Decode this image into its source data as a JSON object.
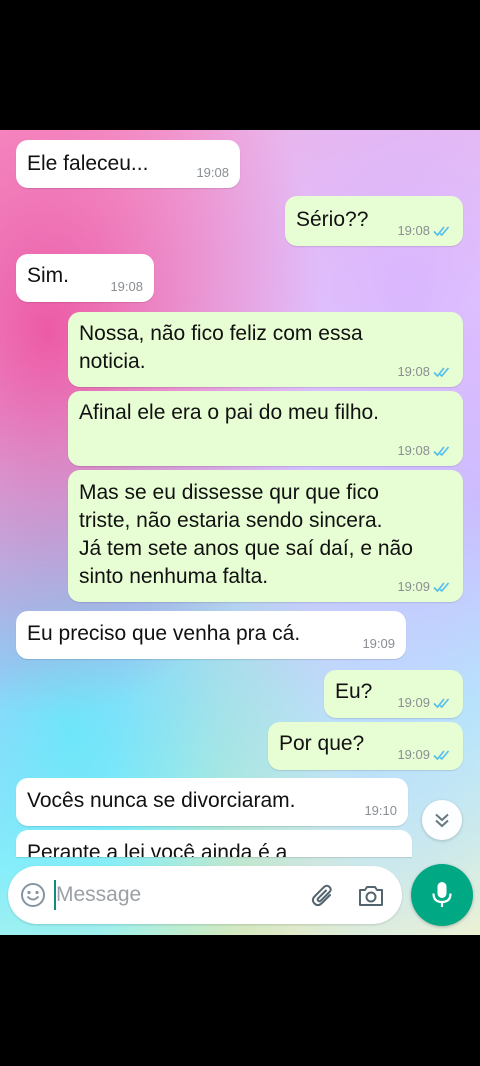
{
  "messages": [
    {
      "direction": "in",
      "text": "Ele faleceu...",
      "time": "19:08"
    },
    {
      "direction": "out",
      "text": "Sério??",
      "time": "19:08",
      "status": "read"
    },
    {
      "direction": "in",
      "text": "Sim.",
      "time": "19:08"
    },
    {
      "direction": "out",
      "text": "Nossa, não fico feliz com essa\nnoticia.",
      "time": "19:08",
      "status": "read"
    },
    {
      "direction": "out",
      "text": "Afinal ele era o pai do meu filho.",
      "time": "19:08",
      "status": "read"
    },
    {
      "direction": "out",
      "text": "Mas se eu dissesse qur que fico\ntriste, não estaria sendo sincera.\nJá tem sete anos que saí daí, e não\nsinto nenhuma falta.",
      "time": "19:09",
      "status": "read"
    },
    {
      "direction": "in",
      "text": "Eu preciso que venha pra cá.",
      "time": "19:09"
    },
    {
      "direction": "out",
      "text": "Eu?",
      "time": "19:09",
      "status": "read"
    },
    {
      "direction": "out",
      "text": "Por que?",
      "time": "19:09",
      "status": "read"
    },
    {
      "direction": "in",
      "text": "Vocês nunca se divorciaram.",
      "time": "19:10"
    },
    {
      "direction": "in",
      "text": "Perante a lei você ainda é a",
      "time": ""
    }
  ],
  "composer": {
    "placeholder": "Message",
    "emoji_icon": "emoji-icon",
    "attach_icon": "paperclip-icon",
    "camera_icon": "camera-icon",
    "mic_icon": "mic-icon"
  },
  "scroll_down_icon": "double-chevron-down-icon",
  "colors": {
    "incoming_bubble": "#ffffff",
    "outgoing_bubble": "#e7fdd3",
    "accent": "#00a884",
    "read_ticks": "#53bdeb",
    "meta_text": "#8a8f93"
  }
}
